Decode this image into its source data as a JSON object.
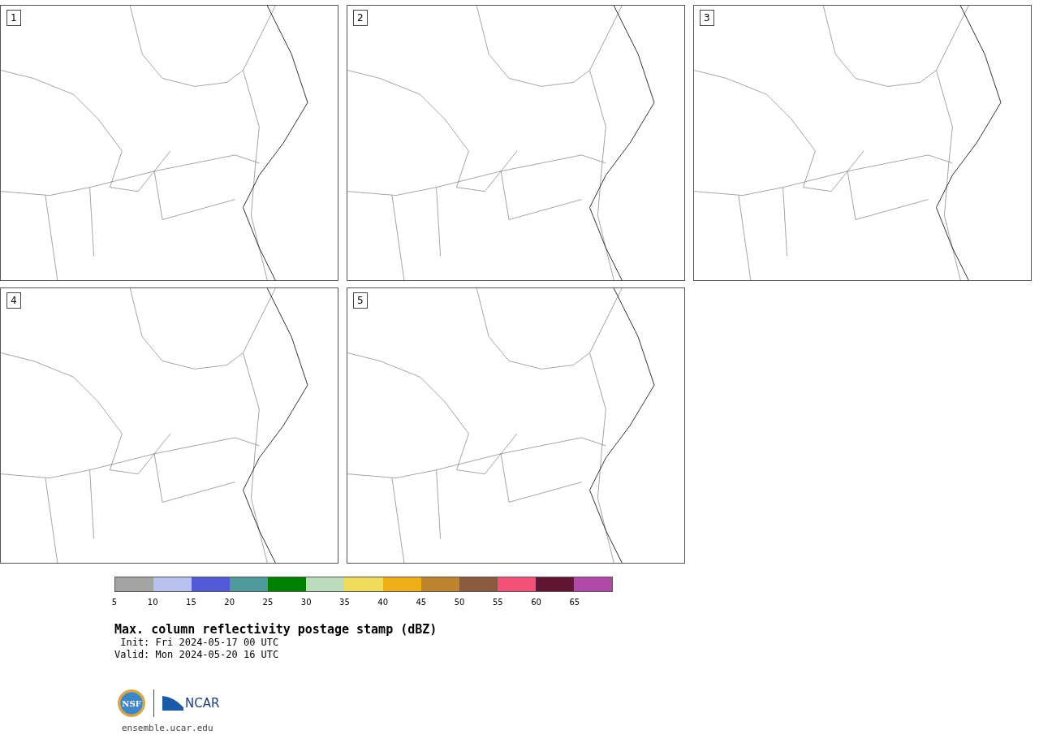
{
  "panels": [
    {
      "label": "1"
    },
    {
      "label": "2"
    },
    {
      "label": "3"
    },
    {
      "label": "4"
    },
    {
      "label": "5"
    }
  ],
  "colorbar": {
    "bins": [
      {
        "label": "5",
        "color": "#a4a4a4"
      },
      {
        "label": "10",
        "color": "#b7c1ec"
      },
      {
        "label": "15",
        "color": "#5259d6"
      },
      {
        "label": "20",
        "color": "#4f989c"
      },
      {
        "label": "25",
        "color": "#008000"
      },
      {
        "label": "30",
        "color": "#bddcbd"
      },
      {
        "label": "35",
        "color": "#eedb5a"
      },
      {
        "label": "40",
        "color": "#eeae17"
      },
      {
        "label": "45",
        "color": "#bd832e"
      },
      {
        "label": "50",
        "color": "#8a5a3e"
      },
      {
        "label": "55",
        "color": "#f3507a"
      },
      {
        "label": "60",
        "color": "#621634"
      },
      {
        "label": "65",
        "color": "#af4aa8"
      }
    ]
  },
  "title": "Max. column reflectivity postage stamp (dBZ)",
  "init": " Init: Fri 2024-05-17 00 UTC",
  "valid": "Valid: Mon 2024-05-20 16 UTC",
  "logo": {
    "seal_text": "NSF",
    "wordmark": "NCAR"
  },
  "site": "ensemble.ucar.edu"
}
